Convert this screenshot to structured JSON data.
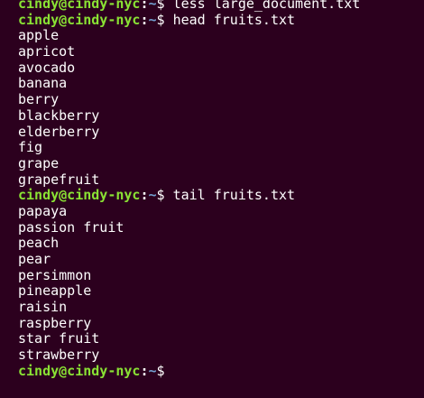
{
  "prompt": {
    "user_host": "cindy@cindy-nyc",
    "sep": ":",
    "path": "~",
    "dollar": "$"
  },
  "session": [
    {
      "type": "command",
      "text": " less large_document.txt"
    },
    {
      "type": "command",
      "text": " head fruits.txt"
    },
    {
      "type": "output",
      "text": "apple"
    },
    {
      "type": "output",
      "text": "apricot"
    },
    {
      "type": "output",
      "text": "avocado"
    },
    {
      "type": "output",
      "text": "banana"
    },
    {
      "type": "output",
      "text": "berry"
    },
    {
      "type": "output",
      "text": "blackberry"
    },
    {
      "type": "output",
      "text": "elderberry"
    },
    {
      "type": "output",
      "text": "fig"
    },
    {
      "type": "output",
      "text": "grape"
    },
    {
      "type": "output",
      "text": "grapefruit"
    },
    {
      "type": "command",
      "text": " tail fruits.txt"
    },
    {
      "type": "output",
      "text": "papaya"
    },
    {
      "type": "output",
      "text": "passion fruit"
    },
    {
      "type": "output",
      "text": "peach"
    },
    {
      "type": "output",
      "text": "pear"
    },
    {
      "type": "output",
      "text": "persimmon"
    },
    {
      "type": "output",
      "text": "pineapple"
    },
    {
      "type": "output",
      "text": "raisin"
    },
    {
      "type": "output",
      "text": "raspberry"
    },
    {
      "type": "output",
      "text": "star fruit"
    },
    {
      "type": "output",
      "text": "strawberry"
    },
    {
      "type": "command",
      "text": ""
    }
  ],
  "colors": {
    "background": "#2c001e",
    "prompt_user": "#8ae234",
    "prompt_path": "#729fcf",
    "text": "#ffffff"
  }
}
